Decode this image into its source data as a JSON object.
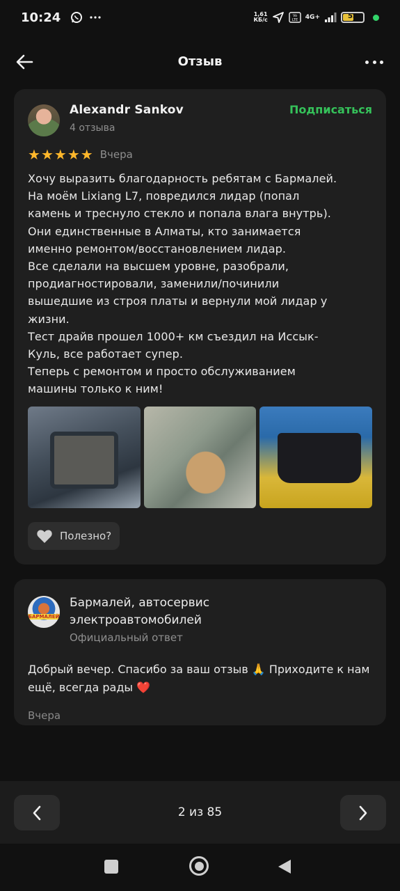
{
  "status_bar": {
    "time": "10:24",
    "net_speed_value": "1,61",
    "net_speed_unit": "КБ/с",
    "network": "4G+",
    "battery": "53",
    "battery_level": 0.53,
    "icons": [
      "whatsapp-icon",
      "more-icon",
      "location-icon",
      "volte-icon",
      "signal-icon",
      "battery-icon"
    ]
  },
  "app_bar": {
    "title": "Отзыв",
    "back_icon": "arrow-left-icon",
    "more_icon": "more-dots-icon"
  },
  "review": {
    "author_name": "Alexandr Sankov",
    "author_reviews": "4 отзыва",
    "subscribe_label": "Подписаться",
    "rating": 5,
    "date": "Вчера",
    "text": "Хочу выразить благодарность ребятам с Бармалей.\nНа моём Lixiang L7, повредился лидар (попал\nкамень и треснуло стекло и попала влага внутрь).\nОни единственные в Алматы, кто занимается\nименно ремонтом/восстановлением лидар.\nВсе сделали на высшем уровне, разобрали,\nпродиагностировали, заменили/починили\nвышедшие из строя платы и вернули мой лидар у\nжизни.\nТест драйв прошел 1000+ км съездил на Иссык-\nКуль, все работает супер.\nТеперь с ремонтом и просто обслуживанием\nмашины только к ним!",
    "photos": [
      "photo-lidar-car",
      "photo-lidar-glass",
      "photo-lidar-module"
    ],
    "helpful_label": "Полезно?"
  },
  "reply": {
    "business_name": "Бармалей, автосервис электроавтомобилей",
    "logo_text": "БАРМАЛЕЙ",
    "label": "Официальный ответ",
    "text": "Добрый вечер. Спасибо за ваш отзыв 🙏 Приходите к нам ещё, всегда рады ❤️",
    "date": "Вчера"
  },
  "pager": {
    "text": "2 из 85",
    "current": 2,
    "total": 85
  },
  "colors": {
    "accent_green": "#35c25a",
    "star": "#ffb72b",
    "card_bg": "#1f1f1f",
    "page_bg": "#111111"
  }
}
